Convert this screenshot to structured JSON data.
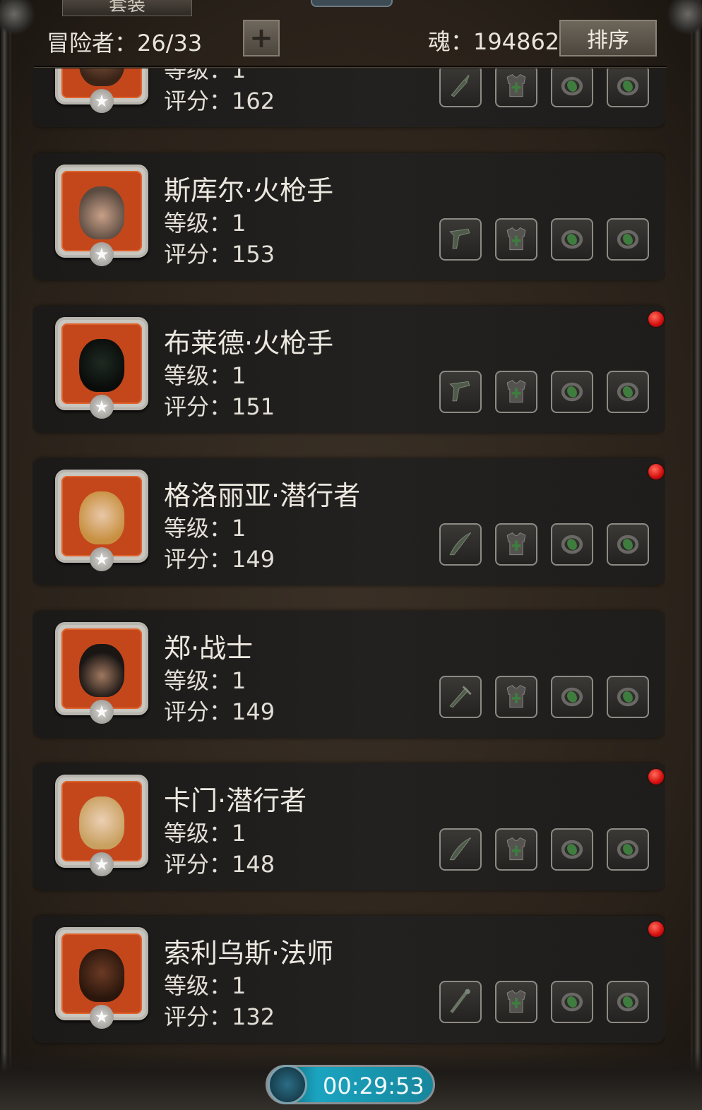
{
  "header": {
    "top_tab_label": "套装",
    "adventurers_label": "冒险者：26/33",
    "add_button_symbol": "+",
    "soul_label": "魂：194862",
    "sort_button_label": "排序"
  },
  "cards": [
    {
      "name": "",
      "level": "等级：1",
      "score": "评分：162",
      "dot": false,
      "partial": true,
      "weapon": "dagger-icon"
    },
    {
      "name": "斯库尔·火枪手",
      "level": "等级：1",
      "score": "评分：153",
      "dot": false,
      "weapon": "pistol-icon"
    },
    {
      "name": "布莱德·火枪手",
      "level": "等级：1",
      "score": "评分：151",
      "dot": true,
      "weapon": "pistol-icon"
    },
    {
      "name": "格洛丽亚·潜行者",
      "level": "等级：1",
      "score": "评分：149",
      "dot": true,
      "weapon": "curved-dagger-icon"
    },
    {
      "name": "郑·战士",
      "level": "等级：1",
      "score": "评分：149",
      "dot": false,
      "weapon": "sword-icon"
    },
    {
      "name": "卡门·潜行者",
      "level": "等级：1",
      "score": "评分：148",
      "dot": true,
      "weapon": "curved-dagger-icon"
    },
    {
      "name": "索利乌斯·法师",
      "level": "等级：1",
      "score": "评分：132",
      "dot": true,
      "weapon": "staff-icon"
    }
  ],
  "portrait_colors": [
    "#5a3a2a",
    "#7a6a5c",
    "#1e2a22",
    "#d8b070",
    "#2a2420",
    "#d4b078",
    "#4a2a1c"
  ],
  "equipment_slot_icons": [
    "weapon-icon",
    "armor-icon",
    "ring-icon",
    "ring-icon"
  ],
  "accent_colors": {
    "slot_green": "#3f7d3f",
    "notification_red": "#e0201a",
    "portrait_frame": "#c4471c"
  },
  "timer": {
    "value": "00:29:53"
  }
}
